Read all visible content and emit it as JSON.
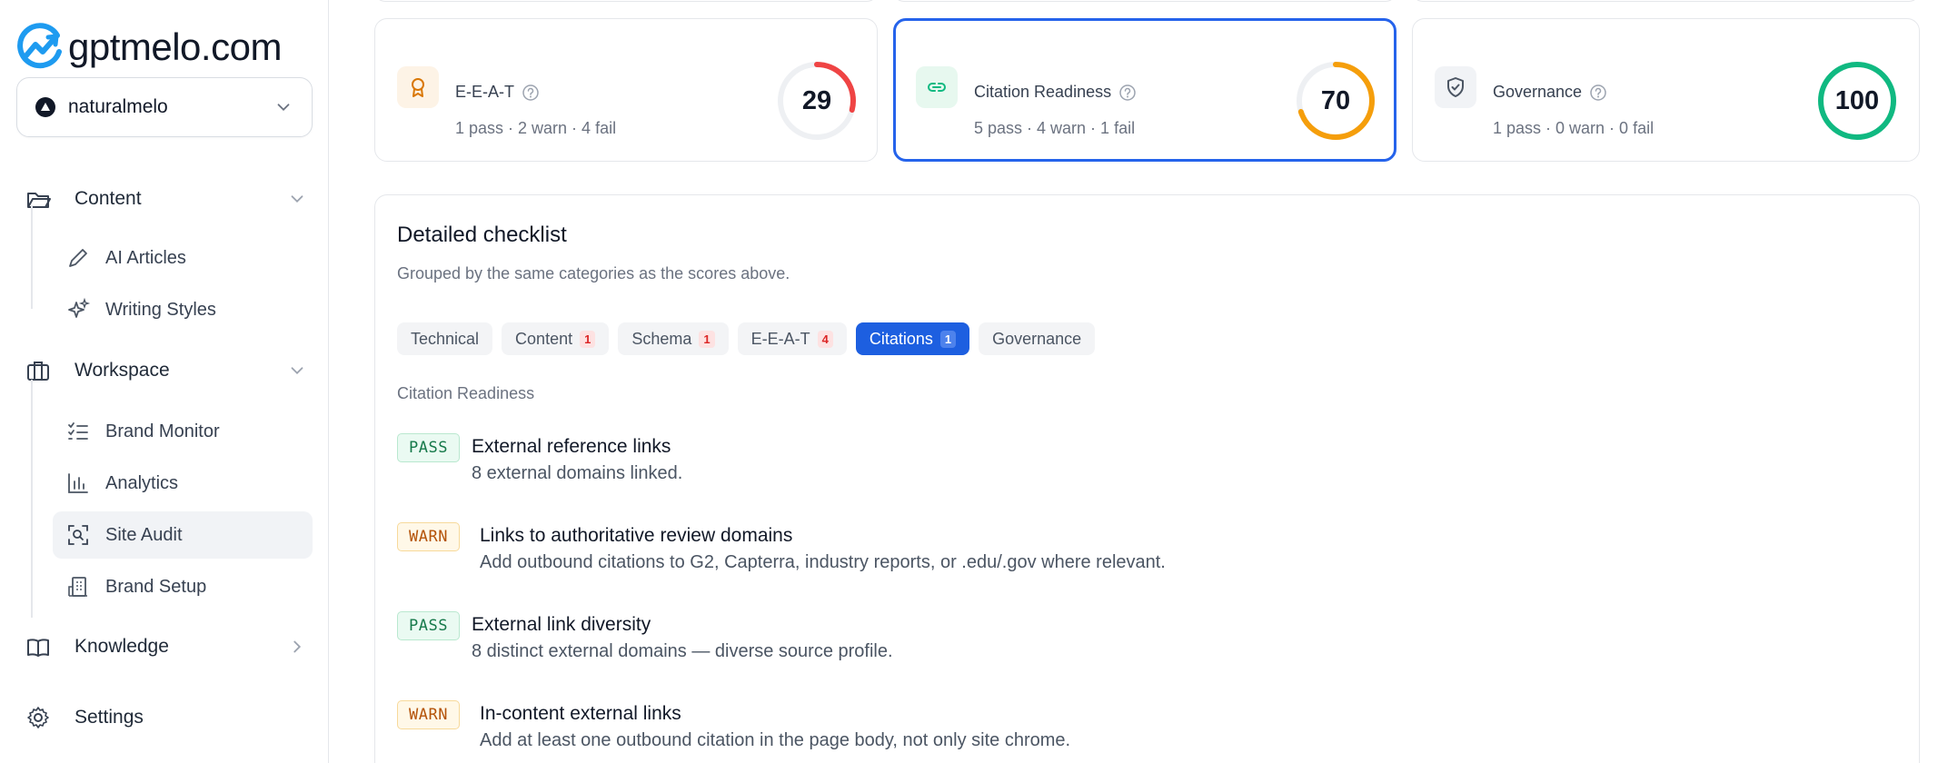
{
  "brand": {
    "name": "gptmelo.com"
  },
  "workspace_selector": {
    "value": "naturalmelo"
  },
  "sidebar": {
    "groups": [
      {
        "label": "Content",
        "items": [
          {
            "label": "AI Articles"
          },
          {
            "label": "Writing Styles"
          }
        ]
      },
      {
        "label": "Workspace",
        "items": [
          {
            "label": "Brand Monitor"
          },
          {
            "label": "Analytics"
          },
          {
            "label": "Site Audit"
          },
          {
            "label": "Brand Setup"
          }
        ]
      },
      {
        "label": "Knowledge",
        "items": []
      },
      {
        "label": "Settings",
        "items": []
      }
    ],
    "active_item": "Site Audit"
  },
  "score_cards": [
    {
      "title": "E-E-A-T",
      "summary": "1 pass · 2 warn · 4 fail",
      "score": "29",
      "score_value": 29,
      "color": "#ef4444",
      "selected": false
    },
    {
      "title": "Citation Readiness",
      "summary": "5 pass · 4 warn · 1 fail",
      "score": "70",
      "score_value": 70,
      "color": "#f59e0b",
      "selected": true
    },
    {
      "title": "Governance",
      "summary": "1 pass · 0 warn · 0 fail",
      "score": "100",
      "score_value": 100,
      "color": "#10b981",
      "selected": false
    }
  ],
  "checklist": {
    "title": "Detailed checklist",
    "subtitle": "Grouped by the same categories as the scores above.",
    "tabs": [
      {
        "label": "Technical",
        "count": ""
      },
      {
        "label": "Content",
        "count": "1"
      },
      {
        "label": "Schema",
        "count": "1"
      },
      {
        "label": "E-E-A-T",
        "count": "4"
      },
      {
        "label": "Citations",
        "count": "1",
        "active": true
      },
      {
        "label": "Governance",
        "count": ""
      }
    ],
    "section_label": "Citation Readiness",
    "items": [
      {
        "status": "PASS",
        "title": "External reference links",
        "desc": "8 external domains linked."
      },
      {
        "status": "WARN",
        "title": "Links to authoritative review domains",
        "desc": "Add outbound citations to G2, Capterra, industry reports, or .edu/.gov where relevant."
      },
      {
        "status": "PASS",
        "title": "External link diversity",
        "desc": "8 distinct external domains — diverse source profile."
      },
      {
        "status": "WARN",
        "title": "In-content external links",
        "desc": "Add at least one outbound citation in the page body, not only site chrome."
      }
    ]
  }
}
